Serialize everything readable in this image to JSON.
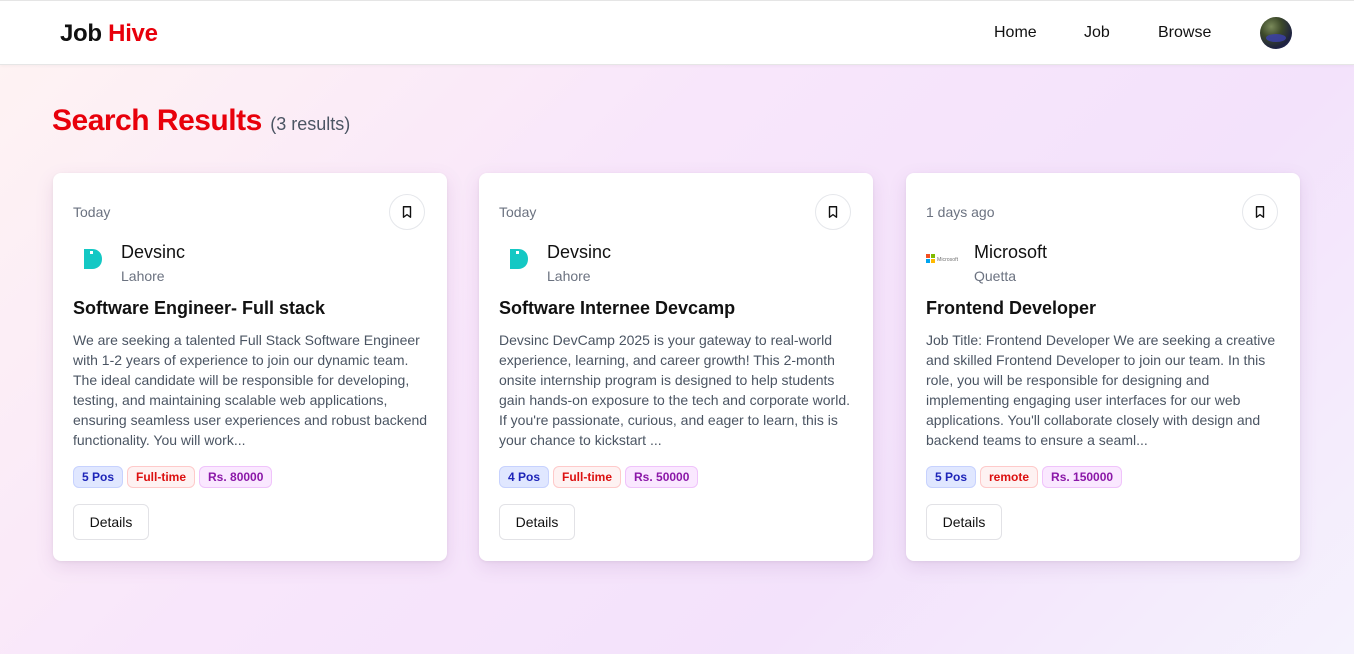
{
  "brand": {
    "part1": "Job",
    "part2": "Hive"
  },
  "nav": {
    "home": "Home",
    "job": "Job",
    "browse": "Browse"
  },
  "header": {
    "title": "Search Results",
    "count": "(3 results)"
  },
  "jobs": [
    {
      "posted": "Today",
      "company": "Devsinc",
      "logo": "devsinc-logo",
      "location": "Lahore",
      "title": "Software Engineer- Full stack",
      "description": "We are seeking a talented Full Stack Software Engineer with 1-2 years of experience to join our dynamic team. The ideal candidate will be responsible for developing, testing, and maintaining scalable web applications, ensuring seamless user experiences and robust backend functionality. You will work...",
      "positions": "5 Pos",
      "type": "Full-time",
      "salary": "Rs. 80000",
      "details_label": "Details"
    },
    {
      "posted": "Today",
      "company": "Devsinc",
      "logo": "devsinc-logo",
      "location": "Lahore",
      "title": "Software Internee Devcamp",
      "description": "Devsinc DevCamp 2025 is your gateway to real-world experience, learning, and career growth! This 2-month onsite internship program is designed to help students gain hands-on exposure to the tech and corporate world. If you're passionate, curious, and eager to learn, this is your chance to kickstart ...",
      "positions": "4 Pos",
      "type": "Full-time",
      "salary": "Rs. 50000",
      "details_label": "Details"
    },
    {
      "posted": "1 days ago",
      "company": "Microsoft",
      "logo": "microsoft-logo",
      "logo_text": "Microsoft",
      "location": "Quetta",
      "title": "Frontend Developer",
      "description": "Job Title: Frontend Developer We are seeking a creative and skilled Frontend Developer to join our team. In this role, you will be responsible for designing and implementing engaging user interfaces for our web applications. You'll collaborate closely with design and backend teams to ensure a seaml...",
      "positions": "5 Pos",
      "type": "remote",
      "salary": "Rs. 150000",
      "details_label": "Details"
    }
  ],
  "colors": {
    "brand_red": "#e8000b",
    "devsinc_teal": "#14c8c4",
    "badge_pos": "#1d24b8",
    "badge_type": "#dc1010",
    "badge_salary": "#8b18a8"
  }
}
